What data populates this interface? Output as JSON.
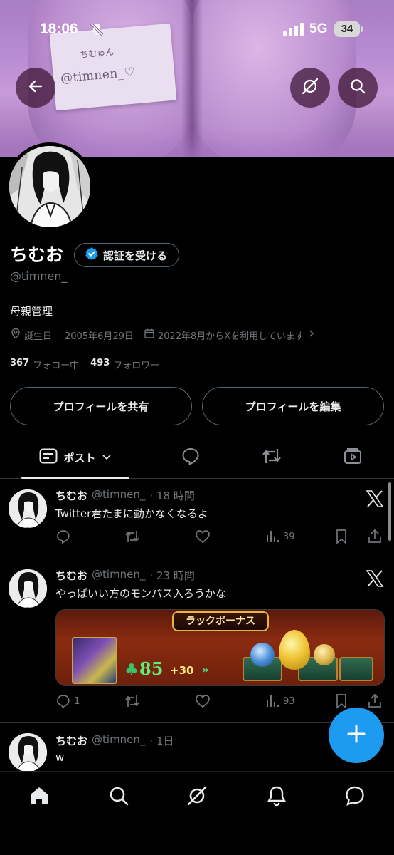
{
  "status_bar": {
    "time": "18:06",
    "network": "5G",
    "battery": "34"
  },
  "banner": {
    "card_line1": "ちむゅん",
    "card_line2": "@timnen_♡"
  },
  "profile": {
    "name": "ちむお",
    "verify_label": "認証を受ける",
    "handle": "@timnen_",
    "bio": "母親管理",
    "birthday_label": "誕生日",
    "birthday": "2005年6月29日",
    "joined": "2022年8月からXを利用しています",
    "following_count": "367",
    "following_label": "フォロー中",
    "followers_count": "493",
    "followers_label": "フォロワー",
    "share_label": "プロフィールを共有",
    "edit_label": "プロフィールを編集"
  },
  "tabs": {
    "posts_label": "ポスト"
  },
  "posts": [
    {
      "name": "ちむお",
      "handle": "@timnen_",
      "time": "· 18 時間",
      "text": "Twitter君たまに動かなくなるよ",
      "replies": "",
      "views": "39"
    },
    {
      "name": "ちむお",
      "handle": "@timnen_",
      "time": "· 23 時間",
      "text": "やっぱいい方のモンパス入ろうかな",
      "replies": "1",
      "views": "93",
      "image": {
        "title": "ラックボーナス",
        "luck": "85",
        "plus": "+30",
        "chev": "»"
      }
    },
    {
      "name": "ちむお",
      "handle": "@timnen_",
      "time": "· 1日",
      "text": "w"
    }
  ],
  "colors": {
    "accent": "#1d9bf0",
    "background": "#000000",
    "muted": "#71767b",
    "border": "#2f3336"
  },
  "icons": [
    "back-arrow-icon",
    "grok-icon",
    "search-icon",
    "verified-badge-icon",
    "location-icon",
    "calendar-icon",
    "reply-icon",
    "repost-icon",
    "like-icon",
    "views-icon",
    "bookmark-icon",
    "share-icon",
    "x-logo-icon",
    "home-icon",
    "notifications-icon",
    "messages-icon",
    "compose-plus-icon"
  ]
}
